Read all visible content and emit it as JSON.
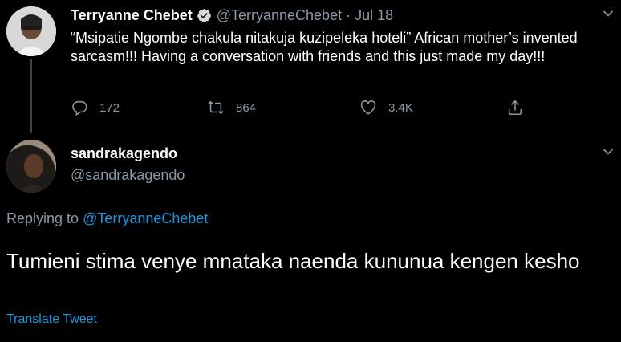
{
  "parent_tweet": {
    "display_name": "Terryanne Chebet",
    "handle": "@TerryanneChebet",
    "separator": "·",
    "date": "Jul 18",
    "text": "“Msipatie Ngombe chakula nitakuja kuzipeleka hoteli” African mother’s invented sarcasm!!!  Having a conversation with friends and this just made my day!!!",
    "reply_count": "172",
    "retweet_count": "864",
    "like_count": "3.4K"
  },
  "reply_tweet": {
    "display_name": "sandrakagendo",
    "handle": "@sandrakagendo",
    "replying_prefix": "Replying to ",
    "replying_to": "@TerryanneChebet",
    "text": "Tumieni stima venye mnataka naenda kununua kengen kesho",
    "translate_label": "Translate Tweet"
  },
  "colors": {
    "background": "#000000",
    "secondary_text": "#8b98a5",
    "link": "#1b95e0",
    "verified_badge": "#d9d9d9"
  },
  "icons": [
    "verified-icon",
    "chevron-down-icon",
    "reply-icon",
    "retweet-icon",
    "like-icon",
    "share-icon"
  ]
}
